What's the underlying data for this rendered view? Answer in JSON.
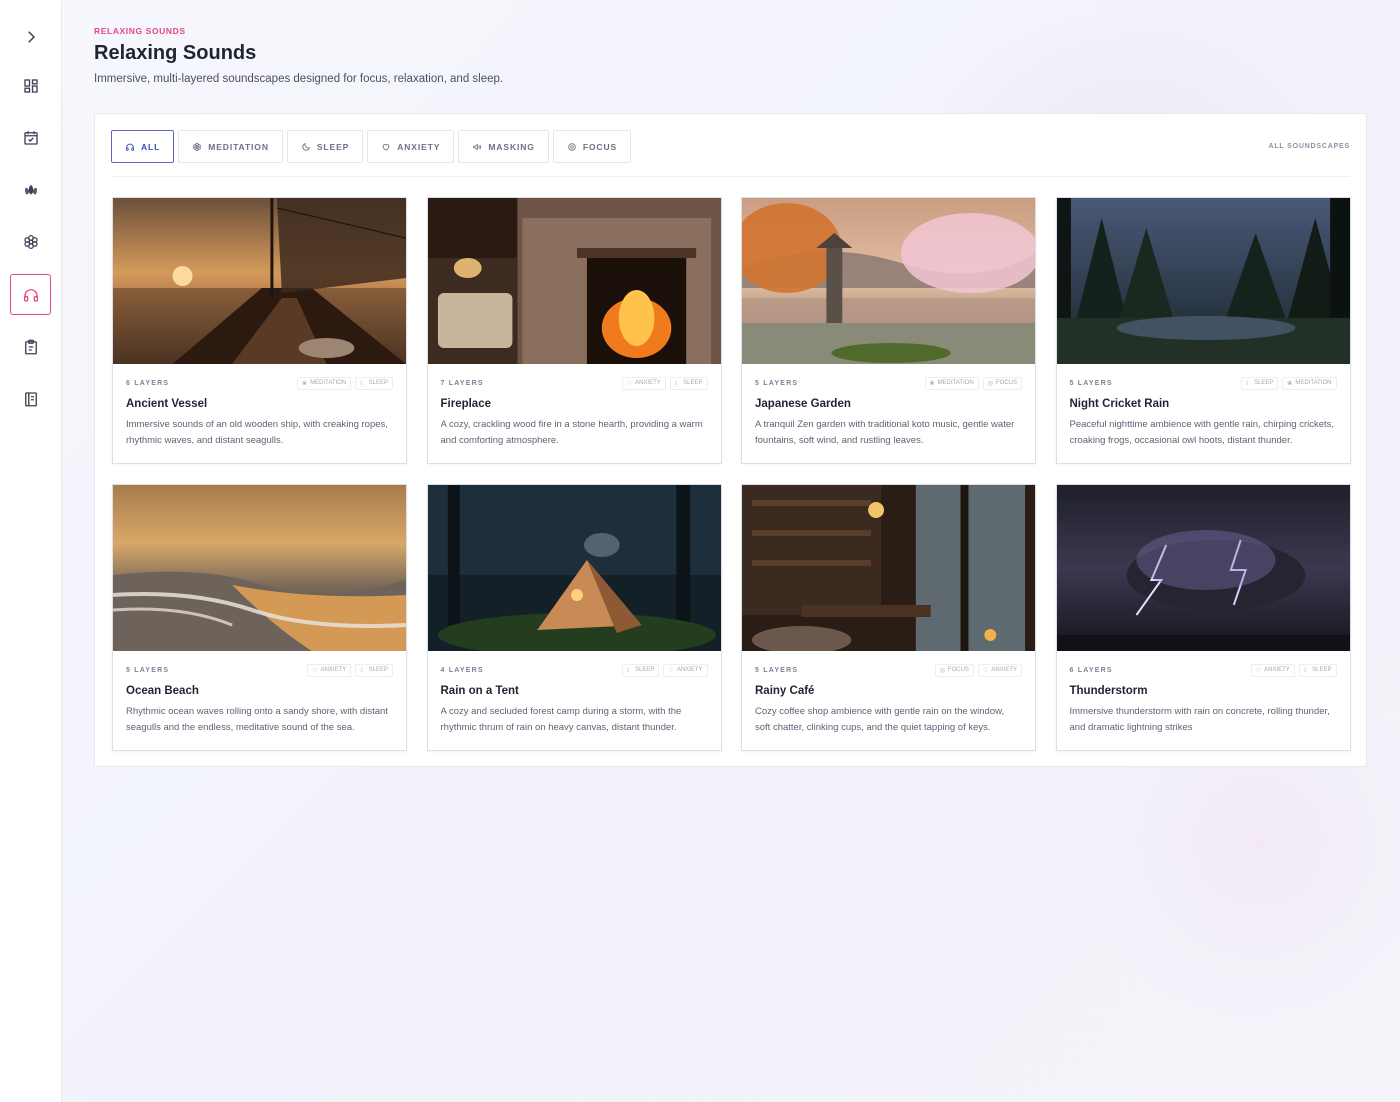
{
  "colors": {
    "accent": "#e4468c",
    "active_filter": "#5d66c9",
    "title": "#1f2433",
    "muted": "#5d6375"
  },
  "sidebar": {
    "items": [
      {
        "icon": "chevron-right-icon",
        "active": false
      },
      {
        "icon": "dashboard-icon",
        "active": false
      },
      {
        "icon": "calendar-check-icon",
        "active": false
      },
      {
        "icon": "lotus-icon",
        "active": false
      },
      {
        "icon": "flower-icon",
        "active": false
      },
      {
        "icon": "headphones-icon",
        "active": true
      },
      {
        "icon": "clipboard-icon",
        "active": false
      },
      {
        "icon": "journal-icon",
        "active": false
      }
    ]
  },
  "header": {
    "eyebrow": "RELAXING SOUNDS",
    "title": "Relaxing Sounds",
    "subtitle": "Immersive, multi-layered soundscapes designed for focus, relaxation, and sleep."
  },
  "filters": [
    {
      "label": "ALL",
      "icon": "headphones-icon",
      "active": true
    },
    {
      "label": "MEDITATION",
      "icon": "flower-icon",
      "active": false
    },
    {
      "label": "SLEEP",
      "icon": "moon-icon",
      "active": false
    },
    {
      "label": "ANXIETY",
      "icon": "heart-icon",
      "active": false
    },
    {
      "label": "MASKING",
      "icon": "sound-icon",
      "active": false
    },
    {
      "label": "FOCUS",
      "icon": "target-icon",
      "active": false
    }
  ],
  "all_link": "ALL SOUNDSCAPES",
  "cards": [
    {
      "layers": "6 LAYERS",
      "tags": [
        "MEDITATION",
        "SLEEP"
      ],
      "title": "Ancient Vessel",
      "desc": "Immersive sounds of an old wooden ship, with creaking ropes, rhythmic waves, and distant seagulls.",
      "image": "ship-image"
    },
    {
      "layers": "7 LAYERS",
      "tags": [
        "ANXIETY",
        "SLEEP"
      ],
      "title": "Fireplace",
      "desc": "A cozy, crackling wood fire in a stone hearth, providing a warm and comforting atmosphere.",
      "image": "fireplace-image"
    },
    {
      "layers": "5 LAYERS",
      "tags": [
        "MEDITATION",
        "FOCUS"
      ],
      "title": "Japanese Garden",
      "desc": "A tranquil Zen garden with traditional koto music, gentle water fountains, soft wind, and rustling leaves.",
      "image": "garden-image"
    },
    {
      "layers": "5 LAYERS",
      "tags": [
        "SLEEP",
        "MEDITATION"
      ],
      "title": "Night Cricket Rain",
      "desc": "Peaceful nighttime ambience with gentle rain, chirping crickets, croaking frogs, occasional owl hoots, distant thunder.",
      "image": "forest-image"
    },
    {
      "layers": "5 LAYERS",
      "tags": [
        "ANXIETY",
        "SLEEP"
      ],
      "title": "Ocean Beach",
      "desc": "Rhythmic ocean waves rolling onto a sandy shore, with distant seagulls and the endless, meditative sound of the sea.",
      "image": "beach-image"
    },
    {
      "layers": "4 LAYERS",
      "tags": [
        "SLEEP",
        "ANXIETY"
      ],
      "title": "Rain on a Tent",
      "desc": "A cozy and secluded forest camp during a storm, with the rhythmic thrum of rain on heavy canvas, distant thunder.",
      "image": "tent-image"
    },
    {
      "layers": "5 LAYERS",
      "tags": [
        "FOCUS",
        "ANXIETY"
      ],
      "title": "Rainy Café",
      "desc": "Cozy coffee shop ambience with gentle rain on the window, soft chatter, clinking cups, and the quiet tapping of keys.",
      "image": "cafe-image"
    },
    {
      "layers": "6 LAYERS",
      "tags": [
        "ANXIETY",
        "SLEEP"
      ],
      "title": "Thunderstorm",
      "desc": "Immersive thunderstorm with rain on concrete, rolling thunder, and dramatic lightning strikes",
      "image": "storm-image"
    }
  ]
}
